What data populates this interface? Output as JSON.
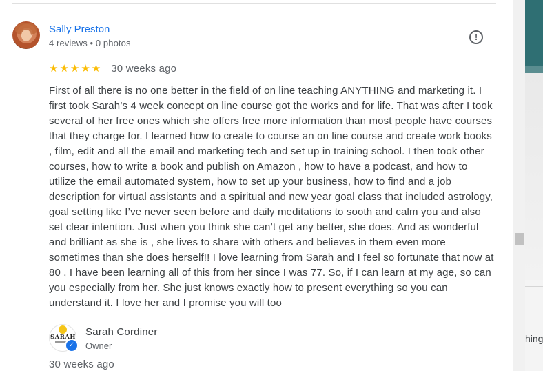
{
  "review": {
    "reviewer_name": "Sally Preston",
    "reviewer_meta": "4 reviews • 0 photos",
    "stars": "★★★★★",
    "rating": 5,
    "time_ago": "30 weeks ago",
    "flag_icon": "!",
    "text": "First of all there is no one better in the field of on line teaching ANYTHING and marketing it. I first took Sarah’s 4 week concept on line course got the works and for life. That was after I took several of her free ones which she offers free more information than most people have courses that they charge for. I learned how to create to course an on line course and create work books , film, edit and all the email and marketing tech and set up in training school. I then took other courses, how to write a book and publish on Amazon , how to have a podcast, and how to utilize the email automated system, how to set up your business, how to find and a job description for virtual assistants and a spiritual and new year goal class that included astrology, goal setting like I’ve never seen before and daily meditations to sooth and calm you and also set clear intention. Just when you think she can’t get any better, she does. And as wonderful and brilliant as she is , she lives to share with others and believes in them even more sometimes than she does herself!! I love learning from Sarah and I feel so fortunate that now at 80 , I have been learning all of this from her since I was 77. So, if I can learn at my age, so can you especially from her. She just knows exactly how to present everything so you can understand it. I love her and I promise you will too"
  },
  "owner_reply": {
    "logo_text": "SARAH",
    "name": "Sarah Cordiner",
    "role": "Owner",
    "time_ago": "30 weeks ago",
    "verified_icon": "✓"
  },
  "right_pane": {
    "partial_text": "hing"
  },
  "colors": {
    "link_blue": "#1a73e8",
    "star_yellow": "#fbbc04",
    "secondary_text": "#5f6368"
  }
}
